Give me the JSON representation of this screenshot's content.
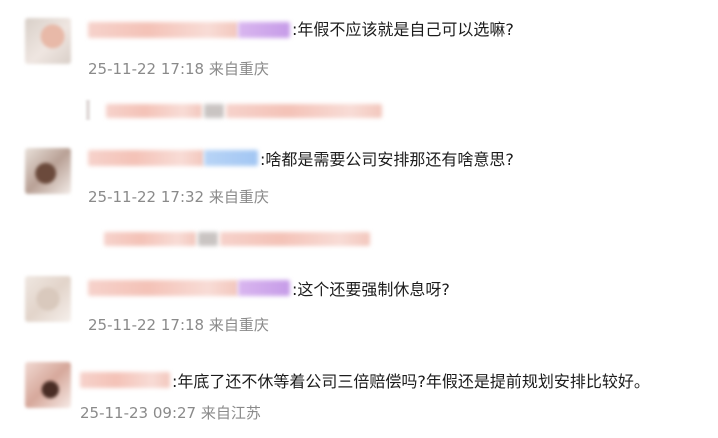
{
  "comments": [
    {
      "text": ":年假不应该就是自己可以选嘛?",
      "meta": "25-11-22 17:18 来自重庆"
    },
    {
      "text": ":啥都是需要公司安排那还有啥意思?",
      "meta": "25-11-22 17:32 来自重庆"
    },
    {
      "text": ":这个还要强制休息呀?",
      "meta": "25-11-22 17:18 来自重庆"
    },
    {
      "text": ":年底了还不休等着公司三倍赔偿吗?年假还是提前规划安排比较好。",
      "meta": "25-11-23 09:27 来自江苏"
    }
  ]
}
